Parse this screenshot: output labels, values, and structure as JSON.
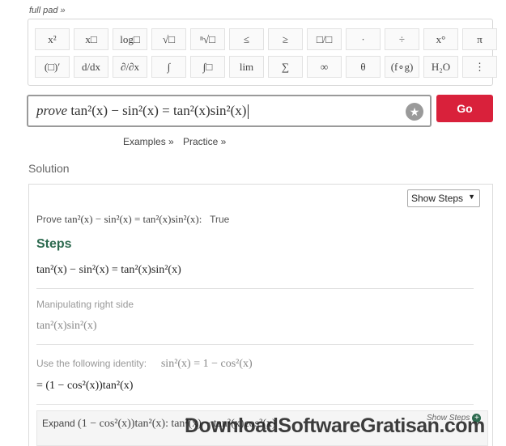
{
  "full_pad_link": "full pad »",
  "keypad": {
    "row1": [
      "x²",
      "x□",
      "log□",
      "√□",
      "ⁿ√□",
      "≤",
      "≥",
      "□/□",
      "·",
      "÷",
      "x°",
      "π"
    ],
    "row2": [
      "(□)′",
      "d/dx",
      "∂/∂x",
      "∫",
      "∫□",
      "lim",
      "∑",
      "∞",
      "θ",
      "(f∘g)",
      "H₂O",
      "⋮"
    ]
  },
  "search": {
    "prefix": "prove",
    "expression": "tan²(x) − sin²(x) = tan²(x)sin²(x)"
  },
  "go_label": "Go",
  "links": {
    "examples": "Examples »",
    "practice": "Practice »"
  },
  "solution_label": "Solution",
  "show_steps_select": "Show Steps",
  "result": {
    "prove_prefix": "Prove",
    "prove_expression": "tan²(x) − sin²(x) = tan²(x)sin²(x):",
    "result_value": "True"
  },
  "steps": {
    "title": "Steps",
    "main_equation": "tan²(x) − sin²(x) = tan²(x)sin²(x)",
    "manipulating_label": "Manipulating right side",
    "manipulating_expression": "tan²(x)sin²(x)",
    "identity_label": "Use the following identity:",
    "identity_expression": "sin²(x) = 1 − cos²(x)",
    "substituted_expression": "= (1 − cos²(x))tan²(x)",
    "expand_label": "Expand",
    "expand_expression": "(1 − cos²(x))tan²(x):",
    "expand_result": "tan²(x) − tan²(x)cos²(x)",
    "show_steps_link": "Show Steps"
  },
  "watermark": "DownloadSoftwareGratisan.com"
}
